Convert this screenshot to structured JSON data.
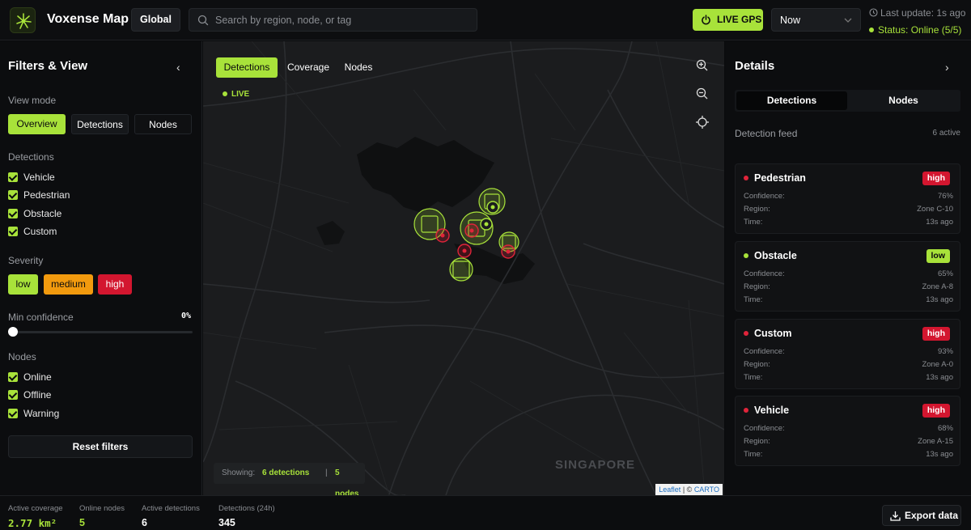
{
  "header": {
    "brand": "Voxense Map",
    "scope_button": "Global",
    "search_placeholder": "Search by region, node, or tag",
    "live_gps_button": "LIVE GPS",
    "time_select": "Now",
    "last_update": "Last update: 1s ago",
    "status": "Status: Online (5/5)"
  },
  "filters": {
    "title": "Filters & View",
    "view_mode_label": "View mode",
    "view_modes": [
      "Overview",
      "Detections",
      "Nodes"
    ],
    "active_view_mode": "Overview",
    "detections_label": "Detections",
    "detection_types": [
      "Vehicle",
      "Pedestrian",
      "Obstacle",
      "Custom"
    ],
    "severity_label": "Severity",
    "severities": [
      {
        "label": "low",
        "bg": "#a8e23a",
        "fg": "#0a0b0d"
      },
      {
        "label": "medium",
        "bg": "#f29a0e",
        "fg": "#0a0b0d"
      },
      {
        "label": "high",
        "bg": "#d3162f",
        "fg": "#ffffff"
      }
    ],
    "min_confidence_label": "Min confidence",
    "min_confidence_value": "0%",
    "min_confidence": 0,
    "nodes_label": "Nodes",
    "node_statuses": [
      "Online",
      "Offline",
      "Warning"
    ],
    "reset_button": "Reset filters"
  },
  "map": {
    "tabs": [
      "Detections",
      "Coverage",
      "Nodes"
    ],
    "active_tab": "Detections",
    "live_label": "LIVE",
    "showing_label": "Showing:",
    "showing_detections": "6 detections",
    "showing_separator": "|",
    "showing_nodes": "5 nodes",
    "city_label": "SINGAPORE",
    "attribution_leaflet": "Leaflet",
    "attribution_sep": "| ©",
    "attribution_carto": "CARTO",
    "controls": [
      "zoom-in-icon",
      "zoom-out-icon",
      "locate-icon"
    ]
  },
  "details": {
    "title": "Details",
    "tabs": [
      "Detections",
      "Nodes"
    ],
    "active_tab": "Detections",
    "feed_label": "Detection feed",
    "feed_count": "6 active",
    "field_labels": {
      "confidence": "Confidence:",
      "region": "Region:",
      "time": "Time:"
    },
    "cards": [
      {
        "name": "Pedestrian",
        "severity": "high",
        "dot": "#e0243a",
        "confidence": "76%",
        "region": "Zone C-10",
        "time": "13s ago"
      },
      {
        "name": "Obstacle",
        "severity": "low",
        "dot": "#a8e23a",
        "confidence": "65%",
        "region": "Zone A-8",
        "time": "13s ago"
      },
      {
        "name": "Custom",
        "severity": "high",
        "dot": "#e0243a",
        "confidence": "93%",
        "region": "Zone A-0",
        "time": "13s ago"
      },
      {
        "name": "Vehicle",
        "severity": "high",
        "dot": "#e0243a",
        "confidence": "68%",
        "region": "Zone A-15",
        "time": "13s ago"
      }
    ]
  },
  "footer": {
    "stats": [
      {
        "label": "Active coverage",
        "value": "2.77 km²"
      },
      {
        "label": "Online nodes",
        "value": "5"
      },
      {
        "label": "Active detections",
        "value": "6"
      },
      {
        "label": "Detections (24h)",
        "value": "345"
      }
    ],
    "export_button": "Export data"
  },
  "colors": {
    "accent": "#a8e23a",
    "high": "#d3162f",
    "medium": "#f29a0e"
  }
}
